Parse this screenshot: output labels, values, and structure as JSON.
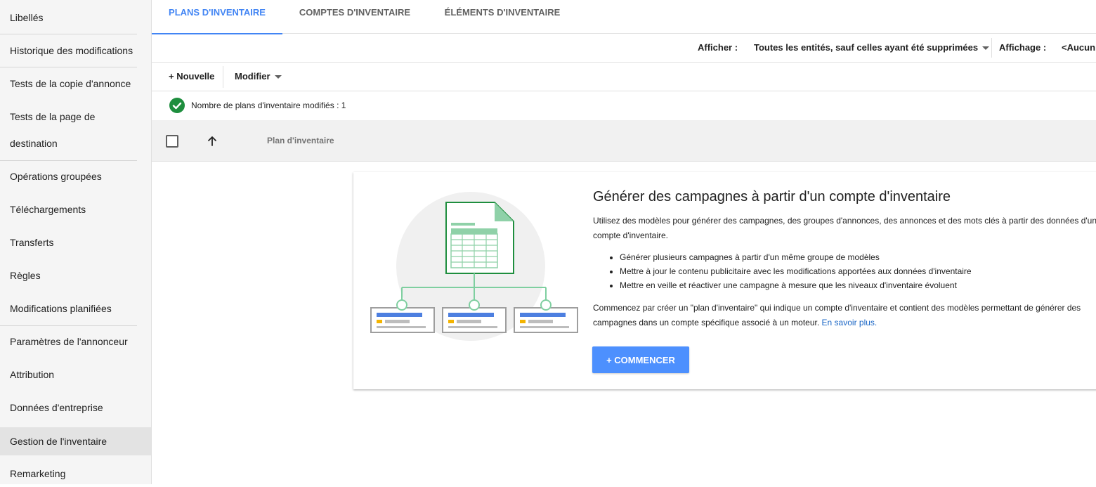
{
  "sidebar": {
    "items": [
      {
        "label": "Libellés"
      },
      {
        "label": "Historique des modifications"
      },
      {
        "label": "Tests de la copie d'annonce"
      },
      {
        "label": "Tests de la page de destination"
      },
      {
        "label": "Opérations groupées"
      },
      {
        "label": "Téléchargements"
      },
      {
        "label": "Transferts"
      },
      {
        "label": "Règles"
      },
      {
        "label": "Modifications planifiées"
      },
      {
        "label": "Paramètres de l'annonceur"
      },
      {
        "label": "Attribution"
      },
      {
        "label": "Données d'entreprise"
      },
      {
        "label": "Gestion de l'inventaire",
        "active": true
      },
      {
        "label": "Remarketing"
      }
    ]
  },
  "tabs": [
    {
      "label": "PLANS D'INVENTAIRE",
      "active": true
    },
    {
      "label": "COMPTES D'INVENTAIRE"
    },
    {
      "label": "ÉLÉMENTS D'INVENTAIRE"
    }
  ],
  "filters": {
    "show_label": "Afficher :",
    "show_value": "Toutes les entités, sauf celles ayant été supprimées",
    "display_label": "Affichage :",
    "display_value": "<Aucun a"
  },
  "toolbar": {
    "new_label": "+ Nouvelle",
    "modify_label": "Modifier"
  },
  "status": {
    "text": "Nombre de plans d'inventaire modifiés : 1",
    "icon": "check-circle-icon",
    "color": "#1e8e3e"
  },
  "table": {
    "column_header": "Plan d'inventaire"
  },
  "empty_state": {
    "title": "Générer des campagnes à partir d'un compte d'inventaire",
    "description": "Utilisez des modèles pour générer des campagnes, des groupes d'annonces, des annonces et des mots clés à partir des données d'un compte d'inventaire.",
    "bullets": [
      "Générer plusieurs campagnes à partir d'un même groupe de modèles",
      "Mettre à jour le contenu publicitaire avec les modifications apportées aux données d'inventaire",
      "Mettre en veille et réactiver une campagne à mesure que les niveaux d'inventaire évoluent"
    ],
    "description2": "Commencez par créer un \"plan d'inventaire\" qui indique un compte d'inventaire et contient des modèles permettant de générer des campagnes dans un compte spécifique associé à un moteur.",
    "link": "En savoir plus.",
    "button": "+ COMMENCER"
  },
  "colors": {
    "accent": "#4285f4",
    "button": "#4d90fe",
    "illustration_green": "#1e8e3e"
  }
}
